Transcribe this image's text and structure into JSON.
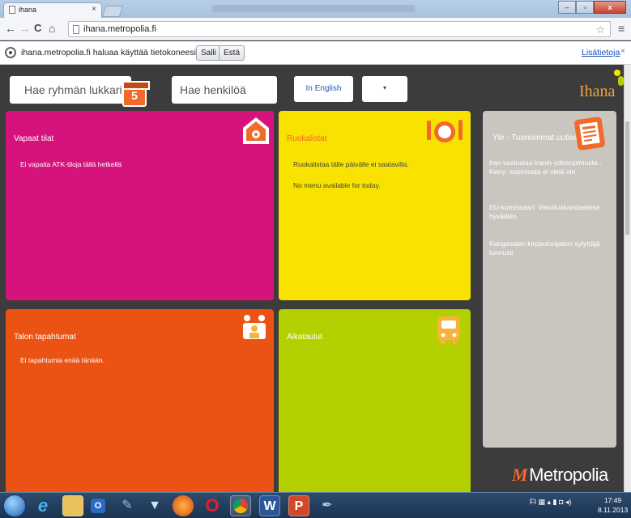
{
  "browser": {
    "tab_title": "ihana",
    "tab_close": "×",
    "url": "ihana.metropolia.fi",
    "back_icon": "arrow-left-icon",
    "forward_icon": "arrow-right-icon",
    "reload_icon": "reload-icon",
    "home_icon": "home-icon",
    "back_glyph": "←",
    "forward_glyph": "→",
    "reload_glyph": "C",
    "home_glyph": "⌂",
    "star_glyph": "☆",
    "menu_glyph": "≡",
    "window_min": "–",
    "window_max": "▫",
    "window_close": "x"
  },
  "infobar": {
    "message": "ihana.metropolia.fi haluaa käyttää tietokoneesi sijaintia.",
    "allow": "Salli",
    "deny": "Estä",
    "more_info": "Lisätietoja",
    "close": "×"
  },
  "header": {
    "group_search_placeholder": "Hae ryhmän lukkaria",
    "calendar_number": "5",
    "person_search_placeholder": "Hae henkilöä",
    "language_button": "In English",
    "dropdown_arrow": "▾",
    "logo": "Ihana"
  },
  "tiles": {
    "vapaat": {
      "title": "Vapaat tilat",
      "text": "Ei vapaita ATK-tiloja tällä hetkellä",
      "color": "#d6127c"
    },
    "ruoka": {
      "title": "Ruokalistat",
      "line1": "Ruokalistaa tälle päivälle ei saatavilla.",
      "line2": "No menu available for today.",
      "color": "#f7e200"
    },
    "talo": {
      "title": "Talon tapahtumat",
      "text": "Ei tapahtumia enää tänään.",
      "color": "#ea5313"
    },
    "aika": {
      "title": "Aikataulut",
      "color": "#b4d000"
    },
    "uutiset": {
      "title": "Yle - Tuoreimmat uutiset",
      "items": [
        "Iran vastustaa Iranin ydinsopimusta - Kerry: sopimusta ei vielä ole",
        "EU-komissaari: Vakoiluskandaalissa hyvääkin",
        "Kangasalan kirpputoripalon sytyttäjä tunnusti"
      ]
    }
  },
  "brand": {
    "name": "Metropolia",
    "accent": "#f1692b"
  },
  "taskbar": {
    "tray_lang": "FI",
    "time": "17:49",
    "date": "8.11.2013",
    "icons": [
      "windows-start-icon",
      "internet-explorer-icon",
      "file-explorer-icon",
      "outlook-icon",
      "tool-icon",
      "network-icon",
      "firefox-icon",
      "opera-icon",
      "chrome-icon",
      "word-icon",
      "powerpoint-icon",
      "pen-icon"
    ]
  }
}
